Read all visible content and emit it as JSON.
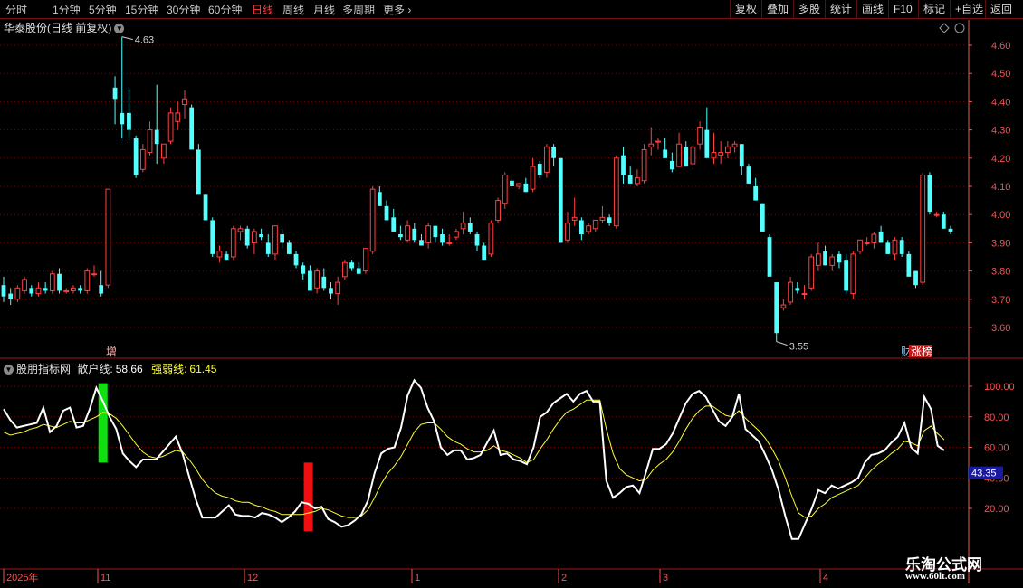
{
  "toolbar": {
    "periods": [
      "分时",
      "1分钟",
      "5分钟",
      "15分钟",
      "30分钟",
      "60分钟",
      "日线",
      "周线",
      "月线",
      "多周期",
      "更多"
    ],
    "active": "日线",
    "buttons": [
      "复权",
      "叠加",
      "多股",
      "统计",
      "画线",
      "F10",
      "标记",
      "+自选",
      "返回"
    ]
  },
  "price_panel": {
    "title": "华泰股份(日线 前复权)",
    "high_label": "4.63",
    "low_label": "3.55",
    "markers": [
      "增",
      "财",
      "涨榜"
    ]
  },
  "indicator_panel": {
    "name": "股朋指标网",
    "line1_label": "散户线:",
    "line1_value": "58.66",
    "line2_label": "强弱线:",
    "line2_value": "61.45",
    "cursor_value": "43.35"
  },
  "date_axis": [
    "2025年",
    "11",
    "12",
    "1",
    "2",
    "3",
    "4"
  ],
  "watermark": {
    "line1": "乐淘公式网",
    "line2": "www.60lt.com"
  },
  "colors": {
    "up": "#ff4040",
    "down": "#54ffff",
    "white_line": "#ffffff",
    "yellow_line": "#ffff33",
    "grid": "#6a0c0c",
    "axis_text": "#ff5050"
  },
  "chart_data": [
    {
      "type": "candlestick",
      "title": "华泰股份(日线 前复权)",
      "y_ticks": [
        3.6,
        3.7,
        3.8,
        3.9,
        4.0,
        4.1,
        4.2,
        4.3,
        4.4,
        4.5,
        4.6
      ],
      "ylim": [
        3.5,
        4.67
      ],
      "x_ticks": [
        "2025年",
        "11",
        "12",
        "1",
        "2",
        "3",
        "4"
      ],
      "ohlc": [
        [
          3.75,
          3.78,
          3.69,
          3.71
        ],
        [
          3.72,
          3.74,
          3.68,
          3.7
        ],
        [
          3.7,
          3.75,
          3.69,
          3.74
        ],
        [
          3.73,
          3.78,
          3.72,
          3.77
        ],
        [
          3.74,
          3.75,
          3.71,
          3.72
        ],
        [
          3.72,
          3.76,
          3.71,
          3.74
        ],
        [
          3.74,
          3.76,
          3.72,
          3.73
        ],
        [
          3.73,
          3.8,
          3.72,
          3.79
        ],
        [
          3.79,
          3.81,
          3.72,
          3.73
        ],
        [
          3.73,
          3.74,
          3.72,
          3.73
        ],
        [
          3.73,
          3.75,
          3.72,
          3.74
        ],
        [
          3.74,
          3.75,
          3.72,
          3.73
        ],
        [
          3.73,
          3.81,
          3.72,
          3.8
        ],
        [
          3.79,
          3.82,
          3.78,
          3.79
        ],
        [
          3.75,
          3.8,
          3.71,
          3.72
        ],
        [
          3.75,
          4.09,
          3.74,
          4.09
        ],
        [
          4.45,
          4.49,
          4.32,
          4.41
        ],
        [
          4.36,
          4.63,
          4.27,
          4.32
        ],
        [
          4.36,
          4.45,
          4.27,
          4.3
        ],
        [
          4.27,
          4.28,
          4.13,
          4.14
        ],
        [
          4.16,
          4.25,
          4.15,
          4.23
        ],
        [
          4.22,
          4.33,
          4.21,
          4.3
        ],
        [
          4.3,
          4.46,
          4.18,
          4.25
        ],
        [
          4.2,
          4.25,
          4.18,
          4.25
        ],
        [
          4.26,
          4.38,
          4.25,
          4.36
        ],
        [
          4.33,
          4.4,
          4.3,
          4.36
        ],
        [
          4.39,
          4.44,
          4.34,
          4.41
        ],
        [
          4.38,
          4.39,
          4.25,
          4.23
        ],
        [
          4.23,
          4.25,
          4.08,
          4.07
        ],
        [
          4.07,
          4.07,
          3.98,
          3.98
        ],
        [
          3.98,
          3.99,
          3.85,
          3.86
        ],
        [
          3.85,
          3.89,
          3.83,
          3.87
        ],
        [
          3.86,
          3.87,
          3.84,
          3.84
        ],
        [
          3.85,
          3.96,
          3.84,
          3.95
        ],
        [
          3.94,
          3.96,
          3.91,
          3.95
        ],
        [
          3.95,
          3.96,
          3.88,
          3.89
        ],
        [
          3.9,
          3.95,
          3.86,
          3.94
        ],
        [
          3.93,
          3.95,
          3.91,
          3.92
        ],
        [
          3.9,
          3.93,
          3.85,
          3.86
        ],
        [
          3.86,
          3.96,
          3.84,
          3.96
        ],
        [
          3.93,
          3.95,
          3.88,
          3.9
        ],
        [
          3.9,
          3.91,
          3.86,
          3.86
        ],
        [
          3.86,
          3.87,
          3.81,
          3.82
        ],
        [
          3.82,
          3.83,
          3.77,
          3.79
        ],
        [
          3.8,
          3.82,
          3.75,
          3.73
        ],
        [
          3.74,
          3.81,
          3.72,
          3.8
        ],
        [
          3.78,
          3.81,
          3.73,
          3.74
        ],
        [
          3.74,
          3.76,
          3.7,
          3.72
        ],
        [
          3.72,
          3.78,
          3.68,
          3.76
        ],
        [
          3.78,
          3.84,
          3.77,
          3.83
        ],
        [
          3.83,
          3.84,
          3.8,
          3.81
        ],
        [
          3.81,
          3.83,
          3.79,
          3.79
        ],
        [
          3.8,
          3.88,
          3.79,
          3.88
        ],
        [
          3.87,
          4.1,
          3.86,
          4.09
        ],
        [
          4.08,
          4.1,
          4.03,
          4.03
        ],
        [
          4.03,
          4.05,
          3.98,
          3.98
        ],
        [
          3.99,
          4.02,
          3.94,
          3.94
        ],
        [
          3.93,
          3.96,
          3.91,
          3.92
        ],
        [
          3.91,
          3.98,
          3.9,
          3.96
        ],
        [
          3.95,
          3.97,
          3.9,
          3.91
        ],
        [
          3.91,
          3.93,
          3.89,
          3.89
        ],
        [
          3.9,
          3.97,
          3.88,
          3.96
        ],
        [
          3.96,
          3.96,
          3.9,
          3.92
        ],
        [
          3.93,
          3.95,
          3.89,
          3.9
        ],
        [
          3.9,
          3.93,
          3.89,
          3.9
        ],
        [
          3.92,
          3.95,
          3.91,
          3.94
        ],
        [
          3.95,
          4.01,
          3.93,
          3.97
        ],
        [
          3.97,
          3.99,
          3.93,
          3.94
        ],
        [
          3.93,
          3.94,
          3.87,
          3.89
        ],
        [
          3.89,
          3.9,
          3.84,
          3.84
        ],
        [
          3.86,
          3.98,
          3.85,
          3.97
        ],
        [
          3.98,
          4.06,
          3.97,
          4.05
        ],
        [
          4.04,
          4.15,
          4.02,
          4.14
        ],
        [
          4.12,
          4.14,
          4.09,
          4.1
        ],
        [
          4.1,
          4.11,
          4.09,
          4.11
        ],
        [
          4.11,
          4.13,
          4.08,
          4.08
        ],
        [
          4.09,
          4.2,
          4.08,
          4.17
        ],
        [
          4.18,
          4.19,
          4.13,
          4.14
        ],
        [
          4.15,
          4.25,
          4.13,
          4.24
        ],
        [
          4.24,
          4.25,
          4.17,
          4.2
        ],
        [
          4.2,
          4.2,
          3.9,
          3.9
        ],
        [
          3.91,
          4.01,
          3.9,
          3.97
        ],
        [
          3.98,
          4.06,
          3.96,
          3.99
        ],
        [
          3.98,
          3.99,
          3.91,
          3.93
        ],
        [
          3.94,
          3.97,
          3.93,
          3.96
        ],
        [
          3.95,
          3.98,
          3.94,
          3.98
        ],
        [
          3.98,
          4.03,
          3.97,
          3.99
        ],
        [
          3.99,
          4.0,
          3.96,
          3.97
        ],
        [
          3.96,
          4.21,
          3.95,
          4.2
        ],
        [
          4.21,
          4.24,
          4.11,
          4.14
        ],
        [
          4.14,
          4.17,
          4.11,
          4.11
        ],
        [
          4.11,
          4.16,
          4.1,
          4.13
        ],
        [
          4.12,
          4.25,
          4.11,
          4.23
        ],
        [
          4.24,
          4.31,
          4.21,
          4.25
        ],
        [
          4.26,
          4.27,
          4.23,
          4.26
        ],
        [
          4.23,
          4.27,
          4.2,
          4.2
        ],
        [
          4.19,
          4.22,
          4.15,
          4.16
        ],
        [
          4.17,
          4.29,
          4.17,
          4.25
        ],
        [
          4.24,
          4.26,
          4.17,
          4.17
        ],
        [
          4.18,
          4.25,
          4.16,
          4.24
        ],
        [
          4.25,
          4.33,
          4.23,
          4.31
        ],
        [
          4.3,
          4.38,
          4.22,
          4.2
        ],
        [
          4.2,
          4.29,
          4.18,
          4.22
        ],
        [
          4.21,
          4.26,
          4.18,
          4.22
        ],
        [
          4.22,
          4.26,
          4.2,
          4.24
        ],
        [
          4.24,
          4.26,
          4.22,
          4.25
        ],
        [
          4.25,
          4.25,
          4.14,
          4.17
        ],
        [
          4.17,
          4.18,
          4.11,
          4.11
        ],
        [
          4.1,
          4.13,
          4.05,
          4.05
        ],
        [
          4.04,
          4.04,
          3.94,
          3.94
        ],
        [
          3.92,
          3.93,
          3.78,
          3.78
        ],
        [
          3.76,
          3.76,
          3.55,
          3.58
        ],
        [
          3.67,
          3.7,
          3.66,
          3.68
        ],
        [
          3.69,
          3.78,
          3.68,
          3.76
        ],
        [
          3.74,
          3.76,
          3.72,
          3.73
        ],
        [
          3.72,
          3.75,
          3.7,
          3.72
        ],
        [
          3.74,
          3.86,
          3.73,
          3.85
        ],
        [
          3.82,
          3.9,
          3.8,
          3.86
        ],
        [
          3.87,
          3.89,
          3.82,
          3.82
        ],
        [
          3.82,
          3.86,
          3.8,
          3.85
        ],
        [
          3.86,
          3.87,
          3.81,
          3.83
        ],
        [
          3.84,
          3.86,
          3.72,
          3.73
        ],
        [
          3.72,
          3.87,
          3.7,
          3.86
        ],
        [
          3.87,
          3.91,
          3.86,
          3.91
        ],
        [
          3.9,
          3.92,
          3.89,
          3.9
        ],
        [
          3.9,
          3.94,
          3.88,
          3.93
        ],
        [
          3.94,
          3.96,
          3.9,
          3.9
        ],
        [
          3.9,
          3.91,
          3.86,
          3.86
        ],
        [
          3.86,
          3.92,
          3.84,
          3.91
        ],
        [
          3.91,
          3.92,
          3.85,
          3.86
        ],
        [
          3.86,
          3.87,
          3.78,
          3.78
        ],
        [
          3.8,
          3.8,
          3.74,
          3.75
        ],
        [
          3.76,
          4.15,
          3.75,
          4.14
        ],
        [
          4.14,
          4.15,
          4.0,
          4.01
        ],
        [
          4.0,
          4.01,
          3.99,
          4.0
        ],
        [
          4.0,
          4.01,
          3.95,
          3.95
        ],
        [
          3.95,
          3.96,
          3.93,
          3.94
        ]
      ]
    },
    {
      "type": "line",
      "title": "股朋指标网",
      "y_ticks": [
        20.0,
        40.0,
        60.0,
        80.0,
        100.0
      ],
      "ylim": [
        0,
        110
      ],
      "series": [
        {
          "name": "散户线",
          "values": [
            85,
            78,
            73,
            74,
            75,
            76,
            86,
            70,
            74,
            84,
            86,
            73,
            74,
            85,
            99,
            90,
            80,
            72,
            56,
            51,
            47,
            52,
            52,
            52,
            57,
            62,
            67,
            56,
            41,
            26,
            14,
            14,
            14,
            18,
            22,
            16,
            15,
            15,
            14,
            17,
            16,
            14,
            11,
            14,
            18,
            24,
            23,
            20,
            21,
            13,
            11,
            8,
            9,
            12,
            16,
            25,
            43,
            56,
            59,
            60,
            73,
            94,
            104,
            99,
            86,
            77,
            60,
            55,
            58,
            58,
            52,
            53,
            55,
            63,
            71,
            55,
            56,
            52,
            51,
            49,
            60,
            80,
            83,
            89,
            92,
            95,
            90,
            95,
            97,
            90,
            90,
            38,
            27,
            30,
            34,
            35,
            30,
            44,
            59,
            59,
            62,
            69,
            79,
            89,
            95,
            97,
            93,
            85,
            77,
            74,
            80,
            95,
            72,
            68,
            64,
            55,
            45,
            32,
            15,
            0,
            0,
            10,
            20,
            32,
            30,
            35,
            33,
            35,
            37,
            40,
            50,
            55,
            56,
            58,
            63,
            67,
            76,
            60,
            56,
            93,
            85,
            61,
            58
          ]
        },
        {
          "name": "强弱线",
          "values": [
            70,
            68,
            69,
            70,
            72,
            73,
            75,
            74,
            73,
            75,
            77,
            76,
            76,
            78,
            80,
            83,
            82,
            79,
            74,
            68,
            62,
            57,
            54,
            53,
            54,
            56,
            58,
            57,
            52,
            46,
            39,
            34,
            30,
            28,
            27,
            25,
            24,
            24,
            22,
            21,
            19,
            18,
            16,
            16,
            16,
            16,
            17,
            18,
            20,
            19,
            17,
            15,
            14,
            14,
            15,
            19,
            27,
            36,
            43,
            48,
            54,
            62,
            70,
            75,
            76,
            76,
            72,
            67,
            64,
            62,
            59,
            57,
            57,
            58,
            61,
            58,
            57,
            55,
            53,
            50,
            52,
            59,
            65,
            72,
            78,
            83,
            85,
            88,
            91,
            91,
            91,
            72,
            56,
            46,
            42,
            40,
            38,
            39,
            45,
            49,
            52,
            57,
            64,
            72,
            79,
            84,
            87,
            87,
            84,
            81,
            80,
            84,
            79,
            75,
            71,
            66,
            59,
            51,
            40,
            28,
            17,
            14,
            15,
            20,
            23,
            27,
            29,
            31,
            33,
            35,
            40,
            45,
            49,
            52,
            56,
            59,
            64,
            63,
            61,
            71,
            74,
            69,
            65
          ]
        }
      ]
    }
  ]
}
